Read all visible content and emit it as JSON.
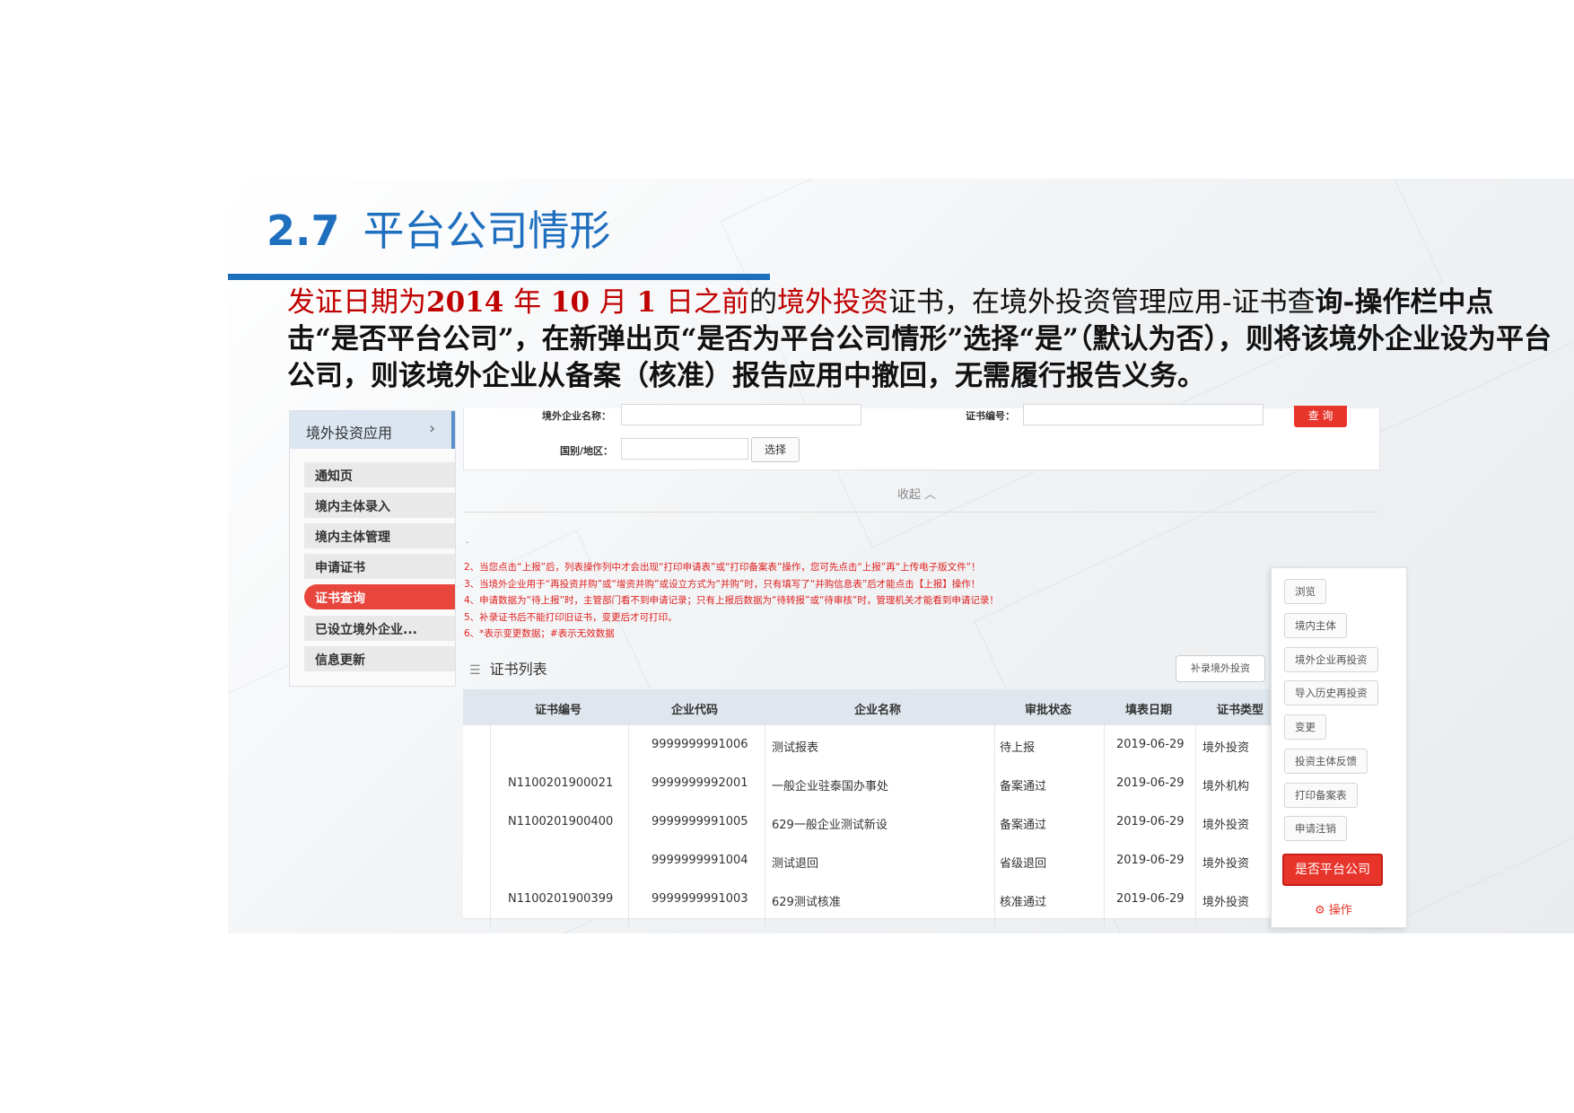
{
  "title": {
    "number": "2.7",
    "text": "平台公司情形"
  },
  "description": {
    "p1": "发证日期为",
    "p2": "2014",
    "p3": "年",
    "p4": "10",
    "p5": "月",
    "p6": "1",
    "p7": "日之前",
    "p8": "的",
    "p9": "境外投资",
    "p10": "证书，在境外投资管理应用-",
    "p11": "证书查",
    "p12": "询-操",
    "p13": "作栏中点击“是否平台公司”，在新弹出页“是否为平台公司情形”选择“是”（默认为否），则将该境外企业设为平台公司，则该境外企业从备案（核准）报告应用中撤回，无需履行报告义务。"
  },
  "sidebar": {
    "header": "境外投资应用",
    "items": [
      "通知页",
      "境内主体录入",
      "境内主体管理",
      "申请证书",
      "证书查询",
      "已设立境外企业...",
      "信息更新"
    ],
    "active_index": 4
  },
  "filter": {
    "company_name_label": "境外企业名称：",
    "cert_no_label": "证书编号：",
    "country_label": "国别/地区：",
    "select_button": "选择",
    "query_button": "查 询",
    "collapse": "收起 ︿"
  },
  "notes": {
    "dot": "·",
    "lines": [
      "2、当您点击“上报”后，列表操作列中才会出现“打印申请表”或“打印备案表”操作，您可先点击“上报”再“上传电子版文件”！",
      "3、当境外企业用于“再投资并购”或“增资并购”或设立方式为“并购”时，只有填写了“并购信息表”后才能点击【上报】操作！",
      "4、申请数据为“待上报”时，主管部门看不到申请记录；只有上报后数据为“待转报”或“待审核”时，管理机关才能看到申请记录！",
      "5、补录证书后不能打印旧证书，变更后才可打印。",
      "6、*表示变更数据；#表示无效数据"
    ]
  },
  "list": {
    "title": "证书列表",
    "supplement_button": "补录境外投资",
    "columns": [
      "证书编号",
      "企业代码",
      "企业名称",
      "审批状态",
      "填表日期",
      "证书类型"
    ],
    "rows": [
      [
        "",
        "9999999991006",
        "测试报表",
        "待上报",
        "2019-06-29",
        "境外投资"
      ],
      [
        "N1100201900021",
        "9999999992001",
        "一般企业驻泰国办事处",
        "备案通过",
        "2019-06-29",
        "境外机构"
      ],
      [
        "N1100201900400",
        "9999999991005",
        "629一般企业测试新设",
        "备案通过",
        "2019-06-29",
        "境外投资"
      ],
      [
        "",
        "9999999991004",
        "测试退回",
        "省级退回",
        "2019-06-29",
        "境外投资"
      ],
      [
        "N1100201900399",
        "9999999991003",
        "629测试核准",
        "核准通过",
        "2019-06-29",
        "境外投资"
      ]
    ]
  },
  "actions": {
    "items": [
      "浏览",
      "境内主体",
      "境外企业再投资",
      "导入历史再投资",
      "变更",
      "投资主体反馈",
      "打印备案表",
      "申请注销"
    ],
    "platform_button": "是否平台公司",
    "ops_label": "⚙ 操作"
  },
  "colors": {
    "accent_blue": "#1f6fbf",
    "accent_red": "#e8352c",
    "desc_red": "#c00000"
  }
}
